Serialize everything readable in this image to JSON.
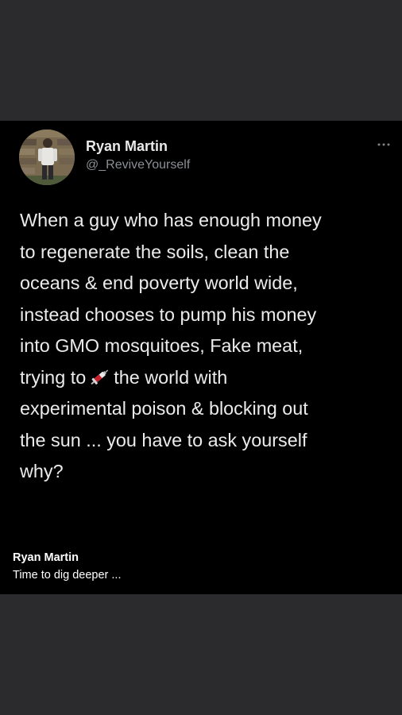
{
  "tweet": {
    "author_name": "Ryan Martin",
    "author_handle": "@_ReviveYourself",
    "avatar_icon": "profile-photo-man-standing",
    "more_icon": "ellipsis-icon",
    "text_lines": [
      "When a guy who has enough money",
      "to regenerate the soils, clean the",
      "oceans & end poverty world wide,",
      "instead chooses to pump his money",
      "into GMO mosquitoes, Fake meat,",
      "trying to",
      "the world with",
      "experimental poison & blocking out",
      "the sun ... you have to ask yourself",
      "why?"
    ],
    "inline_emoji": "syringe-icon"
  },
  "caption": {
    "name": "Ryan Martin",
    "text": "Time to dig deeper ..."
  },
  "colors": {
    "page_background": "#2b2b2d",
    "card_background": "#000000",
    "primary_text": "#ebebeb",
    "secondary_text": "#8b8f93"
  }
}
